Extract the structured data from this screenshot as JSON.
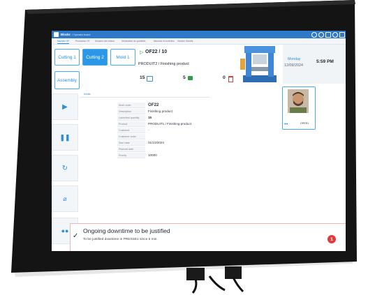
{
  "header": {
    "app_title": "Blocks",
    "breadcrumb": "/ Operator board"
  },
  "tabs": [
    {
      "label": "Machine OF"
    },
    {
      "label": "Production OF"
    },
    {
      "label": "Déclarer des rebuts"
    },
    {
      "label": "Déclaration de quantités"
    },
    {
      "label": "Mesures et contrôles"
    },
    {
      "label": "Gestion d'arrêts"
    }
  ],
  "workstations": {
    "cutting1": "Cutting 1",
    "cutting2": "Cutting 2",
    "mold1": "Mold 1",
    "assembly": "Assembly"
  },
  "order": {
    "id": "OF22 / 10",
    "product": "PRODUIT2 / Finishing product",
    "qty_good": "15",
    "qty_done": "5",
    "qty_scrap": "0"
  },
  "clock": {
    "day": "Monday",
    "date": "12/09/2024",
    "time": "5:59 PM"
  },
  "details": {
    "panel_label": "Details",
    "rows": [
      {
        "label": "Work order",
        "value": "OF22"
      },
      {
        "label": "Description",
        "value": "Finishing product"
      },
      {
        "label": "Launched quantity",
        "value": "15"
      },
      {
        "label": "Product",
        "value": "PRODUIT1 / Finishing product"
      },
      {
        "label": "Customer",
        "value": "-"
      },
      {
        "label": "Customer order",
        "value": ""
      },
      {
        "label": "Start date",
        "value": "01/10/2024"
      },
      {
        "label": "Planned date",
        "value": ""
      },
      {
        "label": "Priority",
        "value": "10000"
      }
    ]
  },
  "operator": {
    "name": "OPER1"
  },
  "alert": {
    "title": "Ongoing downtime to be justified",
    "message": "To be justified downtime in PRESSE1 since 5 min.",
    "count": "1"
  },
  "colors": {
    "accent": "#2b97e6",
    "topbar": "#2f79c9",
    "alert": "#e03b3b",
    "good": "#2f9e44"
  }
}
